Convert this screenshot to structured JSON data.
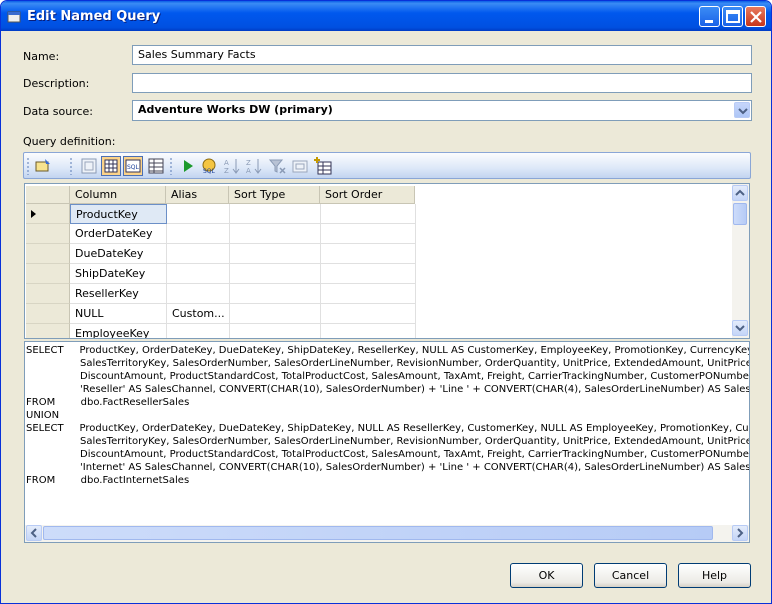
{
  "window": {
    "title": "Edit Named Query"
  },
  "form": {
    "name_label": "Name:",
    "name_value": "Sales Summary Facts",
    "description_label": "Description:",
    "description_value": "",
    "datasource_label": "Data source:",
    "datasource_value": "Adventure Works DW (primary)",
    "query_label": "Query definition:"
  },
  "grid": {
    "headers": [
      "Column",
      "Alias",
      "Sort Type",
      "Sort Order"
    ],
    "rows": [
      {
        "column": "ProductKey",
        "alias": ""
      },
      {
        "column": "OrderDateKey",
        "alias": ""
      },
      {
        "column": "DueDateKey",
        "alias": ""
      },
      {
        "column": "ShipDateKey",
        "alias": ""
      },
      {
        "column": "ResellerKey",
        "alias": ""
      },
      {
        "column": "NULL",
        "alias": "Custom..."
      },
      {
        "column": "EmployeeKey",
        "alias": ""
      }
    ]
  },
  "sql": {
    "lines": [
      "SELECT     ProductKey, OrderDateKey, DueDateKey, ShipDateKey, ResellerKey, NULL AS CustomerKey, EmployeeKey, PromotionKey, CurrencyKey,",
      "                 SalesTerritoryKey, SalesOrderNumber, SalesOrderLineNumber, RevisionNumber, OrderQuantity, UnitPrice, ExtendedAmount, UnitPriceDi",
      "                 DiscountAmount, ProductStandardCost, TotalProductCost, SalesAmount, TaxAmt, Freight, CarrierTrackingNumber, CustomerPONumber,",
      "                 'Reseller' AS SalesChannel, CONVERT(CHAR(10), SalesOrderNumber) + 'Line ' + CONVERT(CHAR(4), SalesOrderLineNumber) AS SalesOr",
      "FROM        dbo.FactResellerSales",
      "UNION",
      "SELECT     ProductKey, OrderDateKey, DueDateKey, ShipDateKey, NULL AS ResellerKey, CustomerKey, NULL AS EmployeeKey, PromotionKey, Curren",
      "                 SalesTerritoryKey, SalesOrderNumber, SalesOrderLineNumber, RevisionNumber, OrderQuantity, UnitPrice, ExtendedAmount, UnitPriceDi",
      "                 DiscountAmount, ProductStandardCost, TotalProductCost, SalesAmount, TaxAmt, Freight, CarrierTrackingNumber, CustomerPONumber,",
      "                 'Internet' AS SalesChannel, CONVERT(CHAR(10), SalesOrderNumber) + 'Line ' + CONVERT(CHAR(4), SalesOrderLineNumber) AS SalesOr",
      "FROM        dbo.FactInternetSales"
    ]
  },
  "buttons": {
    "ok": "OK",
    "cancel": "Cancel",
    "help": "Help"
  },
  "colors": {
    "titlebar": "#0054e3",
    "dialog_bg": "#ece9d8",
    "selection": "#dfe9f5"
  }
}
